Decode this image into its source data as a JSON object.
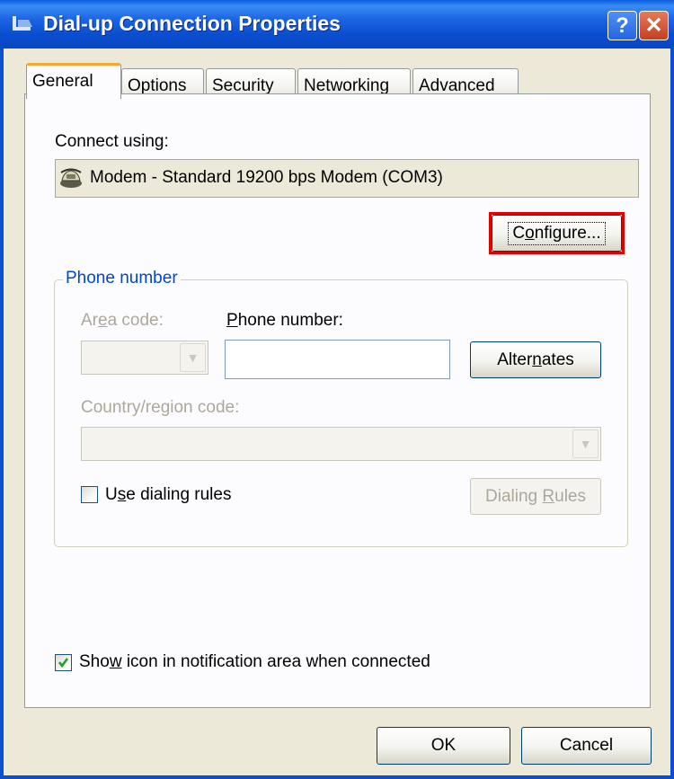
{
  "window": {
    "title": "Dial-up Connection Properties",
    "help_glyph": "?",
    "close_glyph": "✕",
    "colors": {
      "titlebar": "#0a4fd0",
      "close": "#c4401f",
      "face": "#ece9d8",
      "highlight": "#e00000"
    }
  },
  "tabs": [
    {
      "label": "General",
      "active": true
    },
    {
      "label": "Options",
      "active": false
    },
    {
      "label": "Security",
      "active": false
    },
    {
      "label": "Networking",
      "active": false
    },
    {
      "label": "Advanced",
      "active": false
    }
  ],
  "general": {
    "connect_using_label": "Connect using:",
    "device_name": "Modem - Standard 19200 bps Modem (COM3)",
    "device_icon": "modem-icon",
    "configure_button": {
      "before": "C",
      "mnemonic": "o",
      "after": "nfigure..."
    },
    "phone_group": {
      "title": "Phone number",
      "area_code_label": {
        "before": "Ar",
        "mnemonic": "e",
        "after": "a code:"
      },
      "area_code_value": "",
      "phone_number_label": {
        "before": "",
        "mnemonic": "P",
        "after": "hone number:"
      },
      "phone_number_value": "",
      "alternates_button": {
        "before": "Alter",
        "mnemonic": "n",
        "after": "ates"
      },
      "country_label": "Country/region code:",
      "country_value": "",
      "use_dialing_rules": {
        "before": "U",
        "mnemonic": "s",
        "after": "e dialing rules",
        "checked": false
      },
      "dialing_rules_button": {
        "before": "Dialing ",
        "mnemonic": "R",
        "after": "ules"
      }
    },
    "show_icon": {
      "before": "Sho",
      "mnemonic": "w",
      "after": " icon in notification area when connected",
      "checked": true
    }
  },
  "footer": {
    "ok_label": "OK",
    "cancel_label": "Cancel"
  }
}
